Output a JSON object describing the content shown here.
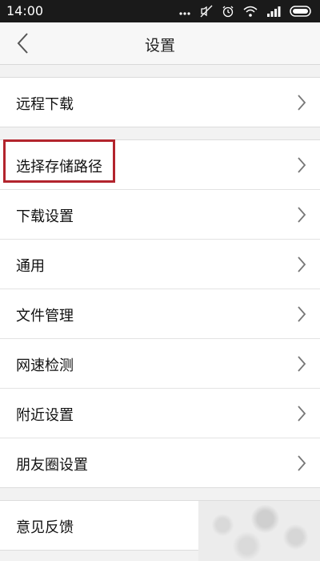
{
  "status_bar": {
    "time": "14:00"
  },
  "header": {
    "title": "设置"
  },
  "groups": [
    {
      "items": [
        {
          "label": "远程下载"
        }
      ]
    },
    {
      "items": [
        {
          "label": "选择存储路径",
          "highlighted": true
        },
        {
          "label": "下载设置"
        },
        {
          "label": "通用"
        },
        {
          "label": "文件管理"
        },
        {
          "label": "网速检测"
        },
        {
          "label": "附近设置"
        },
        {
          "label": "朋友圈设置"
        }
      ]
    },
    {
      "items": [
        {
          "label": "意见反馈"
        }
      ]
    }
  ],
  "colors": {
    "highlight_border": "#b3242d",
    "background": "#f2f2f2",
    "row_bg": "#ffffff"
  },
  "icons": [
    "back-arrow-icon",
    "chevron-right-icon",
    "wifi-icon",
    "signal-icon",
    "battery-icon",
    "alarm-icon",
    "mute-icon"
  ]
}
